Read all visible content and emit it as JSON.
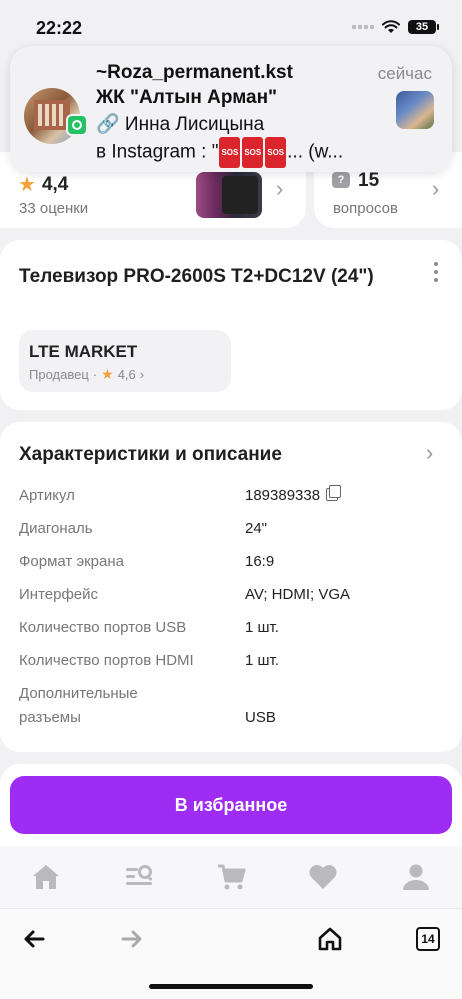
{
  "status_bar": {
    "time": "22:22",
    "battery": "35"
  },
  "notification": {
    "title": "~Roza_permanent.kst",
    "subtitle": "ЖК \"Алтын Арман\"",
    "body_line1": "🔗 Инна Лисицына",
    "body_line2_prefix": "в Instagram : \"",
    "sos_label": "SOS",
    "body_line2_suffix": "... (w...",
    "time": "сейчас",
    "app": "whatsapp-icon"
  },
  "rating": {
    "value": "4,4",
    "count_label": "33 оценки"
  },
  "questions": {
    "value": "15",
    "label": "вопросов"
  },
  "product": {
    "title": "Телевизор PRO-2600S T2+DC12V (24\")",
    "seller": {
      "name": "LTE MARKET",
      "role": "Продавец",
      "separator": "·",
      "rating": "4,6"
    }
  },
  "specs": {
    "title": "Характеристики и описание",
    "rows": [
      {
        "label": "Артикул",
        "value": "189389338"
      },
      {
        "label": "Диагональ",
        "value": "24\""
      },
      {
        "label": "Формат экрана",
        "value": "16:9"
      },
      {
        "label": "Интерфейс",
        "value": "AV; HDMI; VGA"
      },
      {
        "label": "Количество портов USB",
        "value": "1 шт."
      },
      {
        "label": "Количество портов HDMI",
        "value": "1 шт."
      },
      {
        "label": "Дополнительные разъемы",
        "value": "USB"
      }
    ]
  },
  "actions": {
    "favorite_label": "В избранное"
  },
  "bottom_nav": [
    "home-icon",
    "catalog-search-icon",
    "cart-icon",
    "heart-icon",
    "profile-icon"
  ],
  "browser": {
    "tabs_count": "14"
  },
  "colors": {
    "accent": "#9f2cf3",
    "star": "#f3a23b"
  }
}
